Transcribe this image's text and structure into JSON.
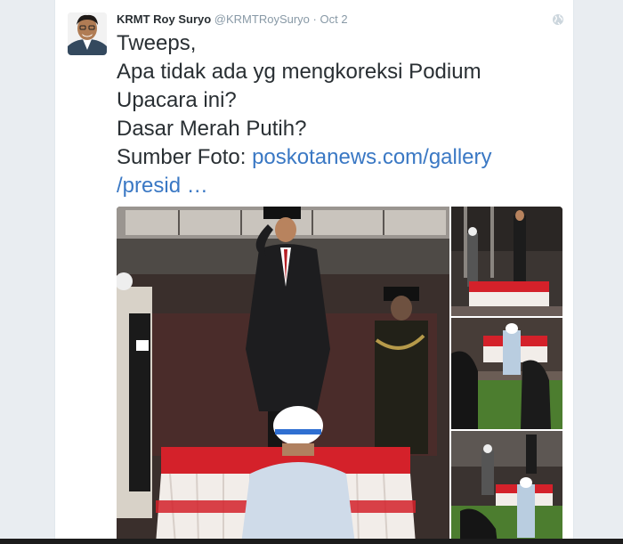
{
  "tweet": {
    "author_name": "KRMT Roy Suryo",
    "handle": "@KRMTRoySuryo",
    "separator": "·",
    "timestamp": "Oct 2",
    "text_lines": [
      "Tweeps,",
      "Apa tidak ada yg mengkoreksi Podium",
      "Upacara ini?",
      "Dasar Merah Putih?",
      "Sumber Foto: "
    ],
    "link_part1": "poskotanews.com/gallery",
    "link_part2": "/presid  …",
    "avatar_icon": "avatar",
    "globe_icon": "globe-icon"
  },
  "colors": {
    "link": "#3a78c4",
    "text": "#292f33",
    "meta": "#8899a6",
    "podium_red": "#d4212a"
  }
}
